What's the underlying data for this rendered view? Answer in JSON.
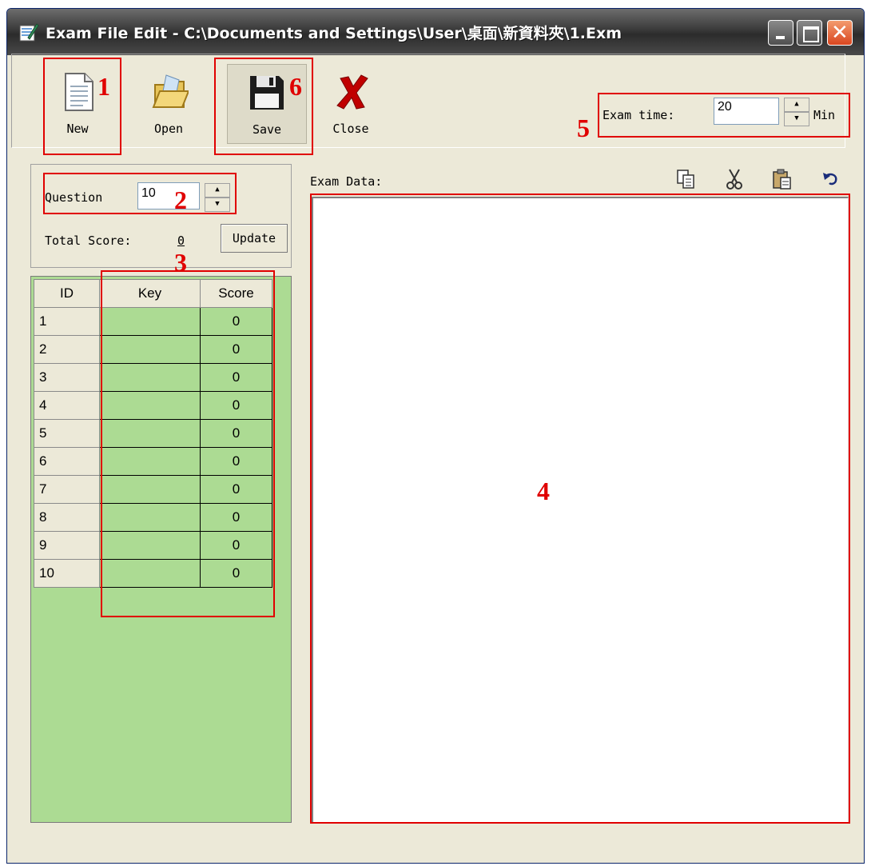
{
  "window": {
    "title": "Exam File Edit - C:\\Documents and Settings\\User\\桌面\\新資料夾\\1.Exm",
    "controls": {
      "minimize": "minimize-icon",
      "maximize": "maximize-icon",
      "close": "✕"
    }
  },
  "toolbar": {
    "new_label": "New",
    "open_label": "Open",
    "save_label": "Save",
    "close_label": "Close",
    "exam_time_label": "Exam time:",
    "exam_time_value": "20",
    "exam_time_unit": "Min"
  },
  "question_panel": {
    "question_label": "Question",
    "question_value": "10",
    "total_score_label": "Total Score:",
    "total_score_value": "0",
    "update_label": "Update"
  },
  "grid": {
    "headers": [
      "ID",
      "Key",
      "Score"
    ],
    "rows": [
      {
        "id": "1",
        "key": "",
        "score": "0"
      },
      {
        "id": "2",
        "key": "",
        "score": "0"
      },
      {
        "id": "3",
        "key": "",
        "score": "0"
      },
      {
        "id": "4",
        "key": "",
        "score": "0"
      },
      {
        "id": "5",
        "key": "",
        "score": "0"
      },
      {
        "id": "6",
        "key": "",
        "score": "0"
      },
      {
        "id": "7",
        "key": "",
        "score": "0"
      },
      {
        "id": "8",
        "key": "",
        "score": "0"
      },
      {
        "id": "9",
        "key": "",
        "score": "0"
      },
      {
        "id": "10",
        "key": "",
        "score": "0"
      }
    ]
  },
  "exam_data": {
    "label": "Exam Data:",
    "icons": [
      "copy-icon",
      "cut-icon",
      "paste-icon",
      "undo-icon"
    ]
  },
  "annotations": {
    "n1": "1",
    "n2": "2",
    "n3": "3",
    "n4": "4",
    "n5": "5",
    "n6": "6"
  },
  "colors": {
    "annotation": "#e00000",
    "grid_fill": "#acdb93",
    "window_face": "#ece9d8"
  }
}
